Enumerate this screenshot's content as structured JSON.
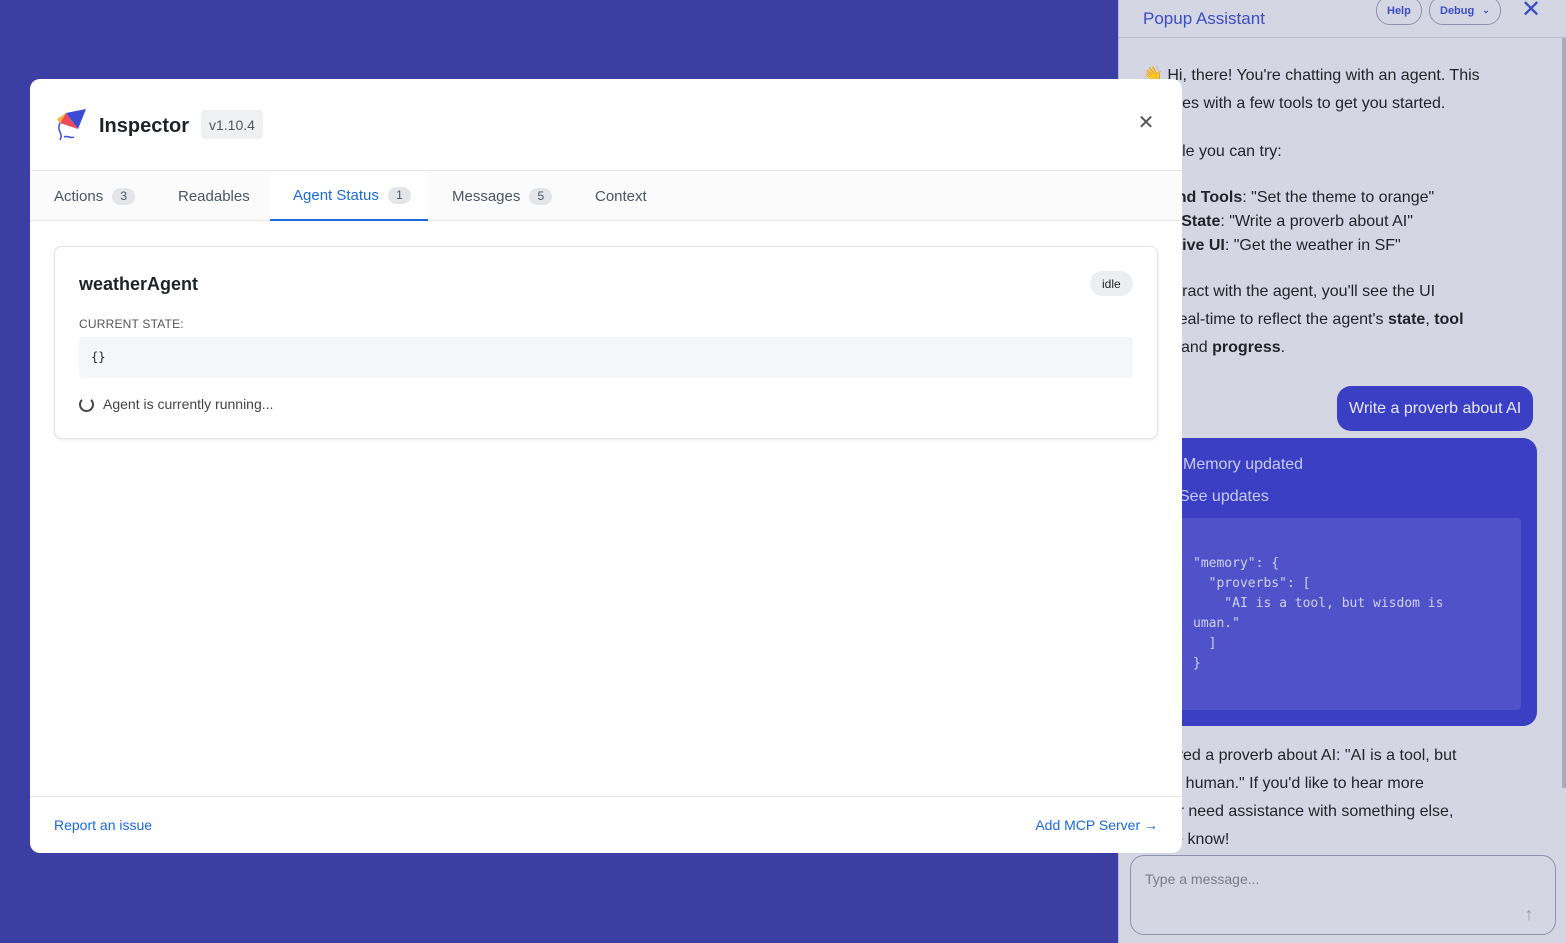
{
  "assistant": {
    "title": "Popup Assistant",
    "help_label": "Help",
    "debug_label": "Debug",
    "intro_line1": "👋 Hi, there! You're chatting with an agent. This",
    "intro_line2": "t comes with a few tools to get you started.",
    "example_intro": "xample you can try:",
    "ex1_bold": "ontend Tools",
    "ex1_text": ": \"Set the theme to orange\"",
    "ex2_bold": "ared State",
    "ex2_text": ": \"Write a proverb about AI\"",
    "ex3_bold": "nerative UI",
    "ex3_text": ": \"Get the weather in SF\"",
    "interact_line1": "u interact with the agent, you'll see the UI",
    "interact_line2_a": "e in real-time to reflect the agent's ",
    "interact_bold_state": "state",
    "interact_sep": ", ",
    "interact_bold_tool": "tool",
    "interact_line3_a": "and ",
    "interact_bold_progress": "progress",
    "interact_end": ".",
    "user_message": "Write a proverb about AI",
    "tool_title": "Memory updated",
    "tool_link": "See updates",
    "tool_code": "\"memory\": {\n  \"proverbs\": [\n    \"AI is a tool, but wisdom is\numan.\"\n  ]\n}",
    "reply_line1": "e stored a proverb about AI: \"AI is a tool, but",
    "reply_line2": "om is human.\" If you'd like to hear more",
    "reply_line3": "rbs or need assistance with something else,",
    "reply_line4": "et me know!",
    "input_placeholder": "Type a message..."
  },
  "inspector": {
    "title": "Inspector",
    "version": "v1.10.4",
    "tabs": [
      {
        "label": "Actions",
        "count": "3"
      },
      {
        "label": "Readables",
        "count": ""
      },
      {
        "label": "Agent Status",
        "count": "1"
      },
      {
        "label": "Messages",
        "count": "5"
      },
      {
        "label": "Context",
        "count": ""
      }
    ],
    "active_tab": "Agent Status",
    "agent": {
      "name": "weatherAgent",
      "status": "idle",
      "state_label": "CURRENT STATE:",
      "state_value": "{}",
      "running_text": "Agent is currently running..."
    },
    "footer": {
      "report_label": "Report an issue",
      "add_mcp_label": "Add MCP Server →"
    }
  },
  "colors": {
    "backdrop": "#3b3fa3",
    "accent": "#1a6ad8",
    "assistant_accent": "#3a4dc4"
  }
}
